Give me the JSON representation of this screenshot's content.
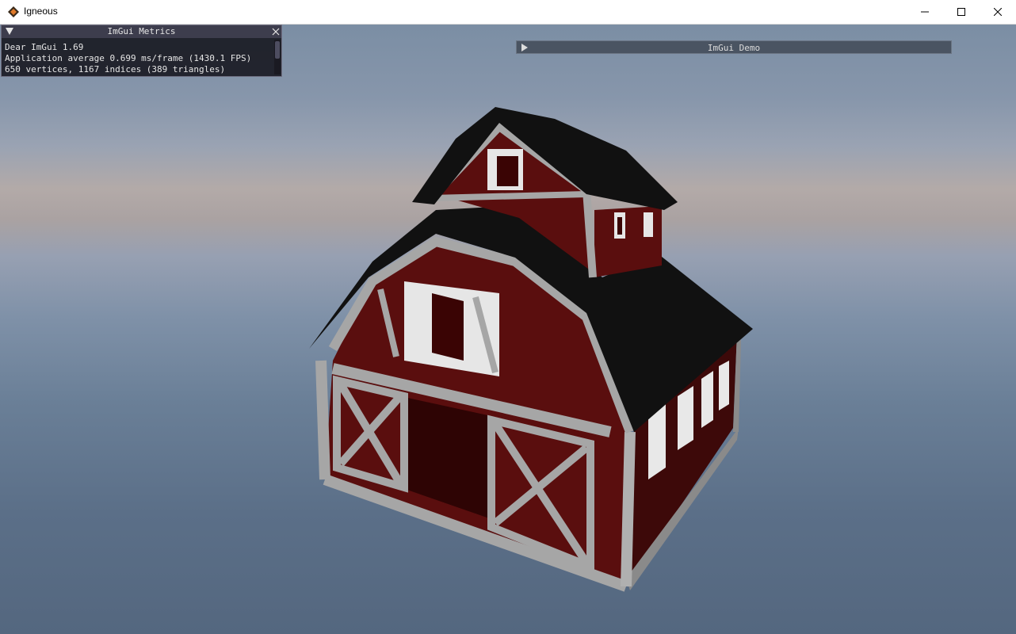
{
  "window": {
    "title": "Igneous",
    "icon": "igneous-diamond-icon",
    "controls": [
      "minimize-icon",
      "maximize-icon",
      "close-icon"
    ]
  },
  "imgui_metrics": {
    "title": "ImGui Metrics",
    "lines": [
      "Dear ImGui 1.69",
      "Application average 0.699 ms/frame (1430.1 FPS)",
      "650 vertices, 1167 indices (389 triangles)"
    ]
  },
  "imgui_demo": {
    "title": "ImGui Demo",
    "collapsed": true
  },
  "colors": {
    "barn_red": "#5a0e0e",
    "barn_trim": "#a6a6a6",
    "roof": "#111111",
    "imgui_title": "#3d3d4d",
    "demo_title": "#4a5462"
  }
}
